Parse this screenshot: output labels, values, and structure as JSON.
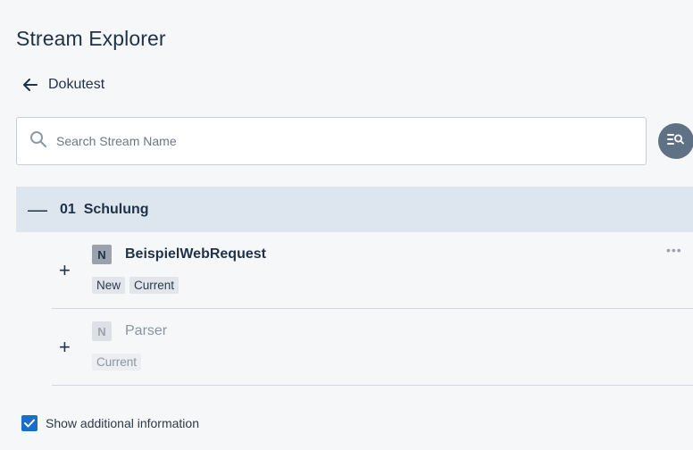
{
  "header": {
    "title": "Stream Explorer"
  },
  "breadcrumb": {
    "back_label": "Dokutest"
  },
  "search": {
    "placeholder": "Search Stream Name",
    "value": ""
  },
  "group": {
    "toggle": "—",
    "label": "01  Schulung"
  },
  "streams": [
    {
      "type": "N",
      "name": "BeispielWebRequest",
      "tags": [
        "New",
        "Current"
      ],
      "more": "•••"
    },
    {
      "type": "N",
      "name": "Parser",
      "tags": [
        "Current"
      ]
    }
  ],
  "expand_symbol": "+",
  "options": {
    "show_additional_label": "Show additional information",
    "show_additional_checked": true
  },
  "colors": {
    "accent": "#1a6ec7",
    "group_bg": "#dde5ee",
    "filter_btn": "#5f7285"
  }
}
